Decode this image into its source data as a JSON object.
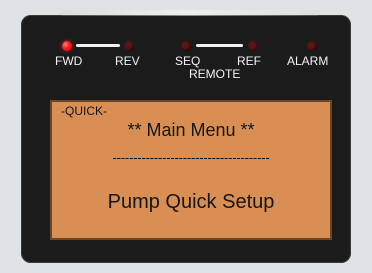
{
  "status_leds": [
    {
      "label": "FWD",
      "state": "on",
      "color": "#ff2020"
    },
    {
      "label": "REV",
      "state": "off",
      "color": "#5a1515"
    },
    {
      "label": "SEQ",
      "state": "off",
      "color": "#5a1515"
    },
    {
      "label": "REF",
      "state": "off",
      "color": "#5a1515"
    },
    {
      "label": "ALARM",
      "state": "off",
      "color": "#5a1515"
    }
  ],
  "remote_label": "REMOTE",
  "lcd": {
    "mode": "-QUICK-",
    "title": "** Main Menu **",
    "divider": "--------------------------------------",
    "item": "Pump Quick Setup",
    "background_color": "#d98f54"
  }
}
